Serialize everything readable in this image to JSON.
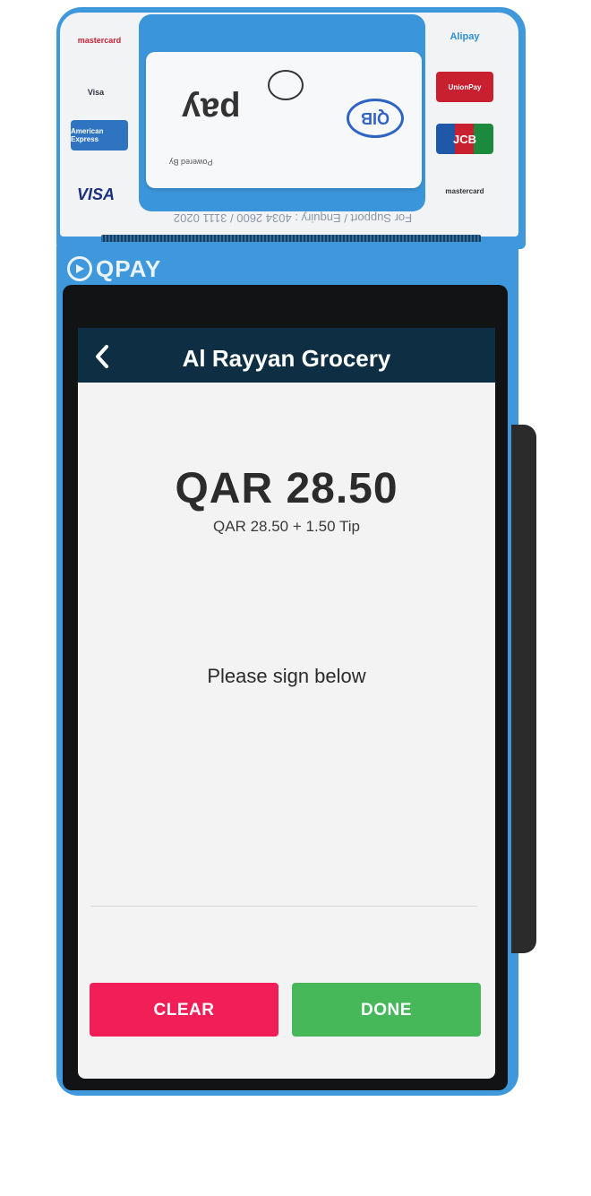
{
  "device": {
    "brand": "QPAY",
    "support_text": "For Support / Enquiry : 4034 2600 / 3111 0202",
    "receipt_brand": "pay",
    "receipt_powered": "Powered By",
    "qib_logo": "QIB",
    "card_logos": [
      "American Express",
      "VISA",
      "Visa",
      "mastercard",
      "JCB",
      "UnionPay",
      "Alipay"
    ]
  },
  "app": {
    "title": "Al Rayyan Grocery",
    "back_icon": "chevron-left-icon"
  },
  "payment": {
    "amount": "QAR 28.50",
    "breakdown": "QAR 28.50 + 1.50 Tip"
  },
  "signature": {
    "prompt": "Please sign below"
  },
  "actions": {
    "clear_label": "CLEAR",
    "done_label": "DONE"
  },
  "colors": {
    "device_blue": "#3f97dc",
    "header_navy": "#0e2f43",
    "clear_red": "#f21e57",
    "done_green": "#46b85a",
    "screen_bg": "#f3f3f3"
  }
}
